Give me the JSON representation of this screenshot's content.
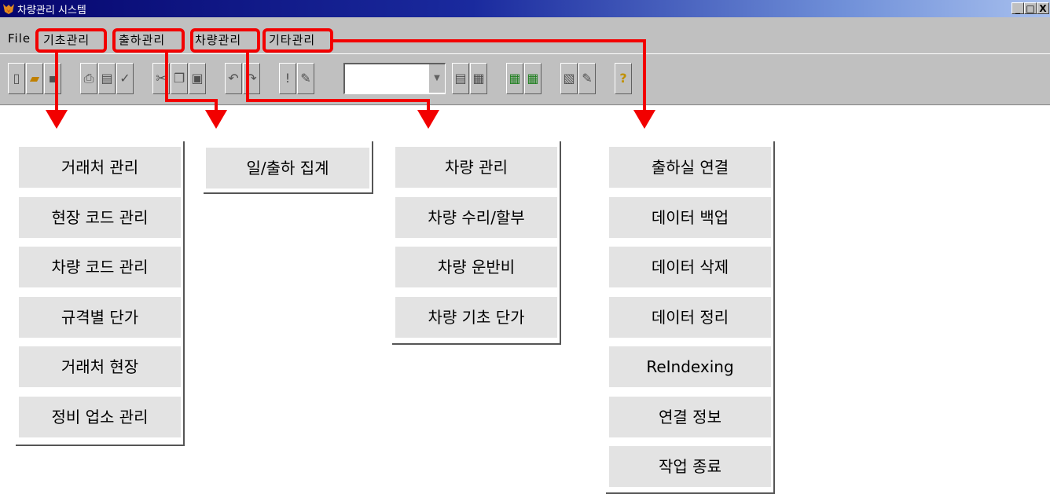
{
  "window": {
    "title": "차량관리 시스템",
    "controls": [
      "_",
      "□",
      "X"
    ]
  },
  "menubar": {
    "items": [
      {
        "label": "File"
      },
      {
        "label": "기초관리"
      },
      {
        "label": "출하관리"
      },
      {
        "label": "차량관리"
      },
      {
        "label": "기타관리"
      }
    ]
  },
  "toolbar": {
    "buttons": [
      "new-doc-icon",
      "open-folder-icon",
      "save-icon",
      "print-icon",
      "print-preview-icon",
      "spellcheck-icon",
      "cut-icon",
      "copy-icon",
      "paste-icon",
      "undo-icon",
      "redo-icon",
      "exclamation-icon",
      "edit-icon",
      "list-icon",
      "report-icon",
      "grid-icon",
      "grid2-icon",
      "database-icon",
      "edit2-icon",
      "help-icon"
    ],
    "combo_value": ""
  },
  "menus": {
    "basic": {
      "items": [
        "거래처 관리",
        "현장 코드 관리",
        "차량 코드 관리",
        "규격별 단가",
        "거래처 현장",
        "정비 업소 관리"
      ]
    },
    "shipping": {
      "items": [
        "일/출하 집계"
      ]
    },
    "vehicle": {
      "items": [
        "차량 관리",
        "차량 수리/할부",
        "차량 운반비",
        "차량 기초 단가"
      ]
    },
    "etc": {
      "items": [
        "출하실 연결",
        "데이터 백업",
        "데이터 삭제",
        "데이터 정리",
        "ReIndexing",
        "연결 정보",
        "작업 종료"
      ]
    }
  },
  "colors": {
    "highlight": "#f20000",
    "menu_button": "#e3e3e3",
    "window_face": "#c0c0c0"
  }
}
